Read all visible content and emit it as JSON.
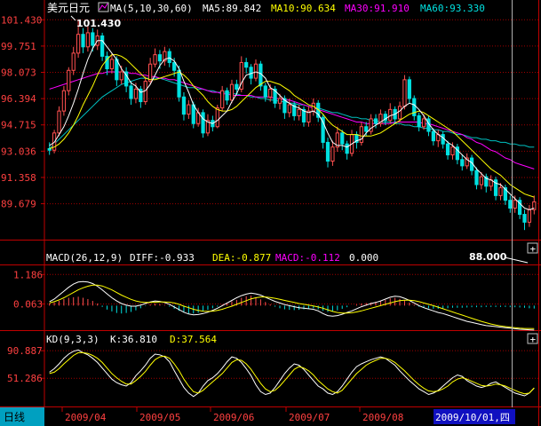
{
  "title": "美元日元",
  "ma_header": {
    "label": "MA(5,10,30,60)",
    "ma5": "MA5:89.842",
    "ma10": "MA10:90.634",
    "ma30": "MA30:91.910",
    "ma60": "MA60:93.330"
  },
  "macd_header": {
    "label": "MACD(26,12,9)",
    "diff": "DIFF:-0.933",
    "dea": "DEA:-0.877",
    "macd": "MACD:-0.112",
    "extra": "0.000"
  },
  "kd_header": {
    "label": "KD(9,3,3)",
    "k": "K:36.810",
    "d": "D:37.564"
  },
  "price_axis": [
    "101.430",
    "99.751",
    "98.073",
    "96.394",
    "94.715",
    "93.036",
    "91.358",
    "89.679"
  ],
  "macd_axis": [
    "1.186",
    "0.063"
  ],
  "kd_axis": [
    "90.887",
    "51.286"
  ],
  "x_axis": [
    "2009/04",
    "2009/05",
    "2009/06",
    "2009/07",
    "2009/08"
  ],
  "period_label": "日线",
  "cursor_date": "2009/10/01,四",
  "high_marker": "101.430",
  "low_marker": "88.000",
  "colors": {
    "up": "#ff5050",
    "down": "#00e0e0",
    "ma5": "#ffffff",
    "ma10": "#ffff00",
    "ma30": "#ff00ff",
    "ma60": "#00c0c0",
    "grid": "#a00000",
    "axis": "#c00000"
  },
  "chart_data": {
    "type": "candlestick",
    "ylim": [
      87.5,
      101.9
    ],
    "candles": [
      [
        93.2,
        93.1,
        93.6,
        92.8
      ],
      [
        93.1,
        94.2,
        94.4,
        92.9
      ],
      [
        94.2,
        95.6,
        95.9,
        94.0
      ],
      [
        95.6,
        96.9,
        97.2,
        95.3
      ],
      [
        96.9,
        98.2,
        98.4,
        96.6
      ],
      [
        98.2,
        99.3,
        99.7,
        97.9
      ],
      [
        99.3,
        100.5,
        101.43,
        99.0
      ],
      [
        100.5,
        99.7,
        100.9,
        99.3
      ],
      [
        99.7,
        100.6,
        101.0,
        99.4
      ],
      [
        100.6,
        99.8,
        100.9,
        99.4
      ],
      [
        99.8,
        100.4,
        100.8,
        99.5
      ],
      [
        100.4,
        99.1,
        100.6,
        98.8
      ],
      [
        99.1,
        98.3,
        99.4,
        97.9
      ],
      [
        98.3,
        98.9,
        99.3,
        98.0
      ],
      [
        98.9,
        97.6,
        99.1,
        97.2
      ],
      [
        97.6,
        98.1,
        98.5,
        97.3
      ],
      [
        98.1,
        97.2,
        98.4,
        96.8
      ],
      [
        97.2,
        96.4,
        97.5,
        96.0
      ],
      [
        96.4,
        97.0,
        97.4,
        96.1
      ],
      [
        97.0,
        96.2,
        97.2,
        95.8
      ],
      [
        96.2,
        97.5,
        97.8,
        96.0
      ],
      [
        97.5,
        98.6,
        99.0,
        97.3
      ],
      [
        98.6,
        99.2,
        99.6,
        98.4
      ],
      [
        99.2,
        98.8,
        99.5,
        98.3
      ],
      [
        98.8,
        99.4,
        99.7,
        98.5
      ],
      [
        99.4,
        98.7,
        99.6,
        98.4
      ],
      [
        98.7,
        98.2,
        99.0,
        97.8
      ],
      [
        98.2,
        96.5,
        98.5,
        96.2
      ],
      [
        96.5,
        95.4,
        96.8,
        95.0
      ],
      [
        95.4,
        96.0,
        96.3,
        95.1
      ],
      [
        96.0,
        94.8,
        96.2,
        94.5
      ],
      [
        94.8,
        95.5,
        95.8,
        94.6
      ],
      [
        95.5,
        94.2,
        95.7,
        93.9
      ],
      [
        94.2,
        95.0,
        95.4,
        94.0
      ],
      [
        95.0,
        94.6,
        95.3,
        94.3
      ],
      [
        94.6,
        95.8,
        96.0,
        94.5
      ],
      [
        95.8,
        96.9,
        97.2,
        95.6
      ],
      [
        96.9,
        96.3,
        97.1,
        96.0
      ],
      [
        96.3,
        97.3,
        97.6,
        96.1
      ],
      [
        97.3,
        97.0,
        97.6,
        96.6
      ],
      [
        97.0,
        98.7,
        99.1,
        96.8
      ],
      [
        98.7,
        98.4,
        99.0,
        98.0
      ],
      [
        98.4,
        97.7,
        98.6,
        97.3
      ],
      [
        97.7,
        98.6,
        98.9,
        97.5
      ],
      [
        98.6,
        97.2,
        98.8,
        96.9
      ],
      [
        97.2,
        96.5,
        97.4,
        96.2
      ],
      [
        96.5,
        97.0,
        97.3,
        96.2
      ],
      [
        97.0,
        96.1,
        97.2,
        95.8
      ],
      [
        96.1,
        96.4,
        96.7,
        95.7
      ],
      [
        96.4,
        95.5,
        96.6,
        95.1
      ],
      [
        95.5,
        96.0,
        96.4,
        95.2
      ],
      [
        96.0,
        95.3,
        96.2,
        95.0
      ],
      [
        95.3,
        95.7,
        96.0,
        95.0
      ],
      [
        95.7,
        94.9,
        95.9,
        94.6
      ],
      [
        94.9,
        95.6,
        95.9,
        94.6
      ],
      [
        95.6,
        96.1,
        96.4,
        95.3
      ],
      [
        96.1,
        95.2,
        96.3,
        94.9
      ],
      [
        95.2,
        93.6,
        95.4,
        93.2
      ],
      [
        93.6,
        92.4,
        93.9,
        92.0
      ],
      [
        92.4,
        93.3,
        93.7,
        92.1
      ],
      [
        93.3,
        94.2,
        94.6,
        93.0
      ],
      [
        94.2,
        93.5,
        94.4,
        93.1
      ],
      [
        93.5,
        92.9,
        93.7,
        92.5
      ],
      [
        92.9,
        94.1,
        94.4,
        92.7
      ],
      [
        94.1,
        93.6,
        94.3,
        93.2
      ],
      [
        93.6,
        94.6,
        94.9,
        93.4
      ],
      [
        94.6,
        94.3,
        94.9,
        94.0
      ],
      [
        94.3,
        95.1,
        95.4,
        94.1
      ],
      [
        95.1,
        94.8,
        95.4,
        94.5
      ],
      [
        94.8,
        95.4,
        95.7,
        94.6
      ],
      [
        95.4,
        95.0,
        95.6,
        94.7
      ],
      [
        95.0,
        95.7,
        96.1,
        94.8
      ],
      [
        95.7,
        95.1,
        95.9,
        94.8
      ],
      [
        95.1,
        95.9,
        96.2,
        94.9
      ],
      [
        95.9,
        97.6,
        97.9,
        95.7
      ],
      [
        97.6,
        96.4,
        97.8,
        96.1
      ],
      [
        96.4,
        95.3,
        96.6,
        95.0
      ],
      [
        95.3,
        94.6,
        95.5,
        94.3
      ],
      [
        94.6,
        95.1,
        95.4,
        94.4
      ],
      [
        95.1,
        94.3,
        95.3,
        94.0
      ],
      [
        94.3,
        93.7,
        94.5,
        93.4
      ],
      [
        93.7,
        94.1,
        94.4,
        93.3
      ],
      [
        94.1,
        93.5,
        94.3,
        93.2
      ],
      [
        93.5,
        92.8,
        93.7,
        92.5
      ],
      [
        92.8,
        93.3,
        93.6,
        92.5
      ],
      [
        93.3,
        92.5,
        93.5,
        92.2
      ],
      [
        92.5,
        92.1,
        92.8,
        91.8
      ],
      [
        92.1,
        92.6,
        92.9,
        91.9
      ],
      [
        92.6,
        91.8,
        92.8,
        91.5
      ],
      [
        91.8,
        90.9,
        92.0,
        90.6
      ],
      [
        90.9,
        91.4,
        91.7,
        90.6
      ],
      [
        91.4,
        90.8,
        91.6,
        90.4
      ],
      [
        90.8,
        91.2,
        91.5,
        90.5
      ],
      [
        91.2,
        90.2,
        91.4,
        89.9
      ],
      [
        90.2,
        90.7,
        91.0,
        89.9
      ],
      [
        90.7,
        89.9,
        90.9,
        89.6
      ],
      [
        89.9,
        89.4,
        90.2,
        89.1
      ],
      [
        89.4,
        89.9,
        90.2,
        89.1
      ],
      [
        89.9,
        89.0,
        90.1,
        88.7
      ],
      [
        89.0,
        88.5,
        89.3,
        88.0
      ],
      [
        88.5,
        89.3,
        89.6,
        88.2
      ],
      [
        89.3,
        89.8,
        90.2,
        89.0
      ]
    ],
    "ma5": [
      93.4,
      93.6,
      94.1,
      94.6,
      95.3,
      96.1,
      97.0,
      98.0,
      98.9,
      99.6,
      100.1,
      100.1,
      99.7,
      99.3,
      98.9,
      98.3,
      97.9,
      97.4,
      97.2,
      96.8,
      96.9,
      97.3,
      97.9,
      98.5,
      98.9,
      99.0,
      98.8,
      98.3,
      97.5,
      96.8,
      96.0,
      95.5,
      95.1,
      94.9,
      94.8,
      95.0,
      95.3,
      95.6,
      96.2,
      96.7,
      97.4,
      97.9,
      98.0,
      98.1,
      98.0,
      97.7,
      97.1,
      96.9,
      96.6,
      96.3,
      96.1,
      95.9,
      95.8,
      95.6,
      95.5,
      95.6,
      95.4,
      94.9,
      94.2,
      93.6,
      93.4,
      93.4,
      93.3,
      93.5,
      93.7,
      93.8,
      94.2,
      94.5,
      94.7,
      94.9,
      95.1,
      95.3,
      95.4,
      95.6,
      95.9,
      96.1,
      96.0,
      95.7,
      95.3,
      94.8,
      94.4,
      94.1,
      93.9,
      93.6,
      93.4,
      93.1,
      92.8,
      92.5,
      92.3,
      91.9,
      91.6,
      91.3,
      91.2,
      91.0,
      90.9,
      90.6,
      90.3,
      90.0,
      89.7,
      89.4,
      89.3,
      89.4
    ],
    "ma10": [
      93.2,
      93.3,
      93.5,
      93.8,
      94.2,
      94.7,
      95.3,
      96.0,
      96.6,
      97.2,
      97.9,
      98.5,
      98.9,
      99.2,
      99.2,
      99.1,
      98.9,
      98.6,
      98.3,
      98.0,
      97.7,
      97.6,
      97.6,
      97.7,
      97.8,
      97.9,
      98.0,
      98.1,
      97.9,
      97.6,
      97.2,
      96.9,
      96.6,
      96.2,
      95.9,
      95.7,
      95.6,
      95.6,
      95.7,
      95.9,
      96.2,
      96.5,
      96.8,
      97.1,
      97.3,
      97.5,
      97.5,
      97.4,
      97.3,
      97.1,
      96.9,
      96.6,
      96.4,
      96.2,
      96.0,
      95.9,
      95.7,
      95.4,
      95.0,
      94.7,
      94.5,
      94.3,
      94.1,
      94.1,
      94.1,
      94.0,
      94.0,
      94.0,
      94.1,
      94.2,
      94.4,
      94.6,
      94.8,
      95.0,
      95.2,
      95.4,
      95.5,
      95.6,
      95.5,
      95.3,
      95.1,
      94.9,
      94.7,
      94.5,
      94.3,
      94.0,
      93.7,
      93.4,
      93.1,
      92.8,
      92.5,
      92.2,
      91.9,
      91.7,
      91.5,
      91.2,
      90.9,
      90.7,
      90.5,
      90.3,
      90.2,
      90.1
    ],
    "ma30": [
      97.0,
      97.1,
      97.2,
      97.3,
      97.4,
      97.5,
      97.6,
      97.7,
      97.8,
      97.9,
      98.0,
      98.0,
      98.1,
      98.1,
      98.1,
      98.1,
      98.1,
      98.0,
      98.0,
      97.9,
      97.9,
      97.8,
      97.8,
      97.7,
      97.7,
      97.6,
      97.6,
      97.5,
      97.4,
      97.3,
      97.2,
      97.1,
      97.0,
      96.9,
      96.8,
      96.8,
      96.7,
      96.7,
      96.6,
      96.6,
      96.6,
      96.6,
      96.6,
      96.5,
      96.5,
      96.5,
      96.5,
      96.4,
      96.4,
      96.3,
      96.3,
      96.2,
      96.1,
      96.0,
      95.9,
      95.8,
      95.7,
      95.6,
      95.5,
      95.4,
      95.3,
      95.2,
      95.1,
      95.0,
      94.9,
      94.9,
      94.8,
      94.8,
      94.8,
      94.8,
      94.8,
      94.8,
      94.9,
      94.9,
      94.9,
      94.9,
      94.9,
      94.9,
      94.8,
      94.8,
      94.7,
      94.6,
      94.5,
      94.4,
      94.3,
      94.2,
      94.1,
      93.9,
      93.8,
      93.6,
      93.5,
      93.3,
      93.1,
      93.0,
      92.8,
      92.6,
      92.5,
      92.3,
      92.2,
      92.1,
      92.0,
      91.9
    ],
    "ma60": [
      93.2,
      93.5,
      93.8,
      94.1,
      94.4,
      94.7,
      95.0,
      95.3,
      95.6,
      95.9,
      96.2,
      96.5,
      96.7,
      96.9,
      97.1,
      97.3,
      97.4,
      97.5,
      97.6,
      97.7,
      97.7,
      97.7,
      97.7,
      97.7,
      97.6,
      97.5,
      97.4,
      97.3,
      97.2,
      97.1,
      97.1,
      97.0,
      97.0,
      96.9,
      96.9,
      96.8,
      96.8,
      96.8,
      96.7,
      96.7,
      96.6,
      96.6,
      96.5,
      96.5,
      96.4,
      96.4,
      96.3,
      96.3,
      96.2,
      96.2,
      96.1,
      96.1,
      96.0,
      96.0,
      95.9,
      95.8,
      95.8,
      95.7,
      95.6,
      95.5,
      95.5,
      95.4,
      95.3,
      95.2,
      95.2,
      95.1,
      95.1,
      95.0,
      95.0,
      94.9,
      94.9,
      94.9,
      94.8,
      94.8,
      94.7,
      94.7,
      94.6,
      94.6,
      94.5,
      94.5,
      94.4,
      94.4,
      94.3,
      94.3,
      94.2,
      94.1,
      94.1,
      94.0,
      93.9,
      93.9,
      93.8,
      93.8,
      93.7,
      93.7,
      93.6,
      93.6,
      93.5,
      93.5,
      93.4,
      93.4,
      93.3,
      93.3
    ],
    "macd_ylim": [
      -0.9,
      1.5
    ],
    "macd_hist": [
      0.08,
      0.12,
      0.18,
      0.25,
      0.3,
      0.32,
      0.34,
      0.3,
      0.25,
      0.18,
      0.08,
      -0.05,
      -0.15,
      -0.22,
      -0.28,
      -0.3,
      -0.28,
      -0.24,
      -0.18,
      -0.1,
      -0.02,
      0.05,
      0.08,
      0.06,
      0.02,
      -0.04,
      -0.12,
      -0.2,
      -0.26,
      -0.3,
      -0.3,
      -0.27,
      -0.22,
      -0.16,
      -0.1,
      -0.04,
      0.04,
      0.1,
      0.16,
      0.22,
      0.3,
      0.36,
      0.38,
      0.32,
      0.24,
      0.14,
      0.05,
      -0.04,
      -0.1,
      -0.14,
      -0.16,
      -0.17,
      -0.16,
      -0.14,
      -0.12,
      -0.1,
      -0.14,
      -0.2,
      -0.24,
      -0.22,
      -0.18,
      -0.12,
      -0.06,
      0.0,
      0.04,
      0.08,
      0.1,
      0.12,
      0.15,
      0.18,
      0.22,
      0.28,
      0.3,
      0.26,
      0.2,
      0.12,
      0.04,
      -0.04,
      -0.08,
      -0.1,
      -0.12,
      -0.12,
      -0.1,
      -0.1,
      -0.08,
      -0.08,
      -0.08,
      -0.07,
      -0.06,
      -0.06,
      -0.06,
      -0.05,
      -0.05,
      -0.05,
      -0.05,
      -0.05,
      -0.06,
      -0.06,
      -0.07,
      -0.08,
      -0.1,
      -0.11
    ],
    "macd_diff": [
      0.15,
      0.25,
      0.4,
      0.55,
      0.7,
      0.82,
      0.9,
      0.92,
      0.9,
      0.84,
      0.74,
      0.6,
      0.45,
      0.3,
      0.18,
      0.08,
      0.02,
      -0.02,
      -0.02,
      0.02,
      0.08,
      0.14,
      0.18,
      0.16,
      0.12,
      0.05,
      -0.05,
      -0.15,
      -0.25,
      -0.32,
      -0.35,
      -0.34,
      -0.3,
      -0.25,
      -0.18,
      -0.1,
      0.0,
      0.1,
      0.2,
      0.3,
      0.38,
      0.44,
      0.48,
      0.45,
      0.4,
      0.32,
      0.24,
      0.16,
      0.1,
      0.04,
      0.0,
      -0.04,
      -0.08,
      -0.1,
      -0.12,
      -0.14,
      -0.2,
      -0.3,
      -0.38,
      -0.4,
      -0.38,
      -0.33,
      -0.26,
      -0.2,
      -0.12,
      -0.04,
      0.02,
      0.08,
      0.12,
      0.18,
      0.25,
      0.32,
      0.36,
      0.34,
      0.28,
      0.2,
      0.1,
      0.0,
      -0.08,
      -0.14,
      -0.2,
      -0.26,
      -0.3,
      -0.36,
      -0.42,
      -0.48,
      -0.54,
      -0.6,
      -0.64,
      -0.68,
      -0.72,
      -0.76,
      -0.78,
      -0.8,
      -0.82,
      -0.84,
      -0.86,
      -0.88,
      -0.9,
      -0.91,
      -0.92,
      -0.93
    ],
    "macd_dea": [
      0.1,
      0.15,
      0.22,
      0.3,
      0.4,
      0.5,
      0.6,
      0.68,
      0.74,
      0.78,
      0.78,
      0.75,
      0.68,
      0.6,
      0.5,
      0.4,
      0.32,
      0.24,
      0.18,
      0.14,
      0.12,
      0.12,
      0.13,
      0.14,
      0.14,
      0.13,
      0.1,
      0.05,
      -0.02,
      -0.08,
      -0.14,
      -0.18,
      -0.21,
      -0.22,
      -0.21,
      -0.18,
      -0.14,
      -0.08,
      -0.02,
      0.05,
      0.12,
      0.19,
      0.26,
      0.3,
      0.33,
      0.33,
      0.31,
      0.28,
      0.24,
      0.2,
      0.16,
      0.12,
      0.08,
      0.05,
      0.02,
      -0.01,
      -0.05,
      -0.1,
      -0.16,
      -0.22,
      -0.26,
      -0.28,
      -0.28,
      -0.27,
      -0.24,
      -0.2,
      -0.15,
      -0.1,
      -0.05,
      0.0,
      0.05,
      0.1,
      0.15,
      0.19,
      0.21,
      0.21,
      0.19,
      0.15,
      0.1,
      0.05,
      0.0,
      -0.06,
      -0.12,
      -0.18,
      -0.24,
      -0.3,
      -0.36,
      -0.42,
      -0.48,
      -0.54,
      -0.6,
      -0.65,
      -0.7,
      -0.74,
      -0.77,
      -0.8,
      -0.82,
      -0.84,
      -0.86,
      -0.87,
      -0.87,
      -0.877
    ],
    "kd_ylim": [
      12,
      100
    ],
    "k": [
      60,
      65,
      72,
      80,
      86,
      90,
      92,
      88,
      85,
      80,
      74,
      66,
      58,
      50,
      45,
      42,
      40,
      45,
      55,
      62,
      70,
      80,
      86,
      85,
      82,
      75,
      62,
      50,
      38,
      30,
      25,
      30,
      40,
      48,
      52,
      58,
      66,
      75,
      82,
      80,
      74,
      65,
      55,
      42,
      32,
      28,
      30,
      38,
      48,
      58,
      66,
      72,
      70,
      64,
      56,
      48,
      40,
      36,
      30,
      28,
      32,
      40,
      50,
      60,
      68,
      72,
      75,
      78,
      80,
      82,
      80,
      75,
      70,
      62,
      55,
      48,
      42,
      36,
      32,
      28,
      30,
      34,
      40,
      46,
      52,
      56,
      54,
      48,
      44,
      40,
      38,
      40,
      44,
      46,
      42,
      38,
      34,
      30,
      28,
      26,
      30,
      37
    ],
    "d": [
      58,
      60,
      65,
      72,
      78,
      84,
      88,
      88,
      87,
      84,
      80,
      74,
      66,
      58,
      52,
      47,
      43,
      43,
      48,
      54,
      61,
      70,
      78,
      82,
      83,
      80,
      72,
      62,
      50,
      40,
      32,
      30,
      34,
      40,
      46,
      52,
      58,
      66,
      74,
      78,
      77,
      72,
      64,
      54,
      44,
      36,
      32,
      34,
      40,
      48,
      56,
      64,
      68,
      66,
      62,
      56,
      48,
      42,
      36,
      32,
      30,
      34,
      42,
      50,
      58,
      64,
      70,
      74,
      77,
      80,
      80,
      78,
      74,
      68,
      62,
      55,
      48,
      42,
      37,
      33,
      32,
      33,
      36,
      40,
      46,
      50,
      52,
      50,
      47,
      44,
      41,
      40,
      41,
      43,
      42,
      40,
      37,
      34,
      31,
      29,
      30,
      37.5
    ]
  }
}
